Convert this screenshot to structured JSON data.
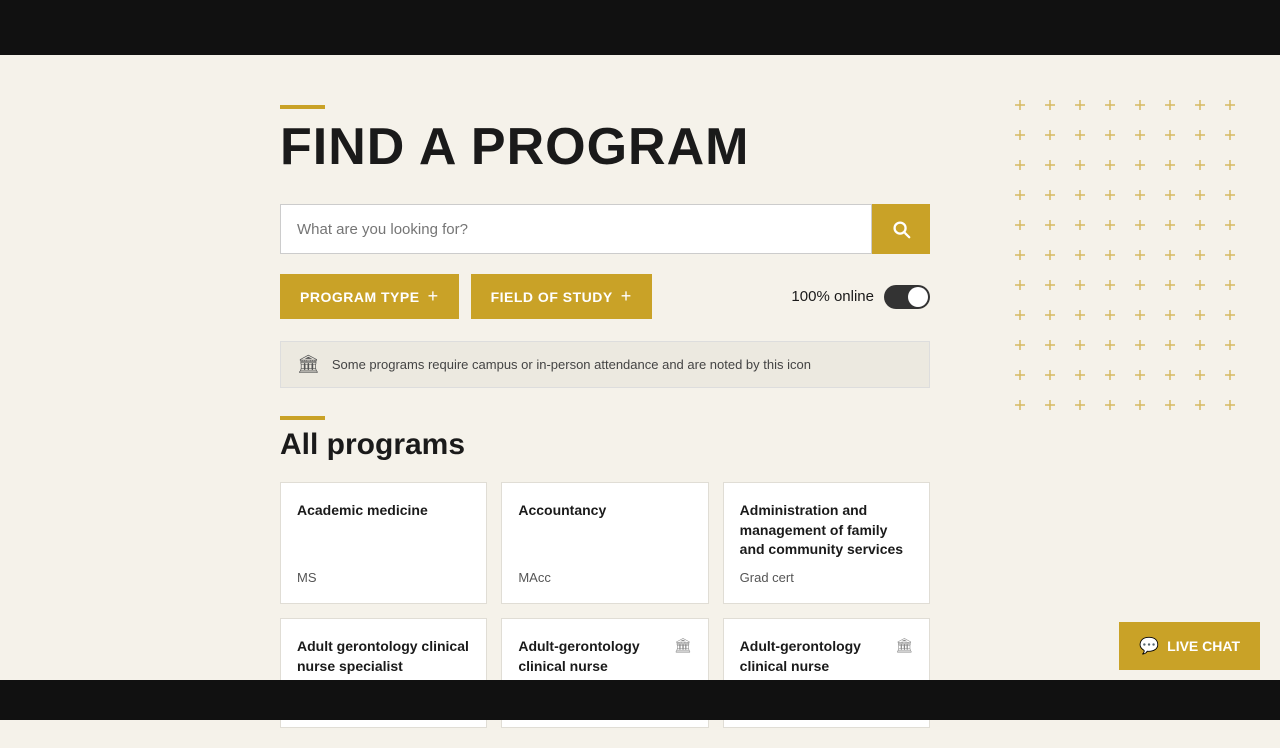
{
  "page": {
    "title": "FIND A PROGRAM",
    "title_accent_color": "#c9a227"
  },
  "search": {
    "placeholder": "What are you looking for?",
    "button_label": "Search"
  },
  "filters": [
    {
      "id": "program-type",
      "label": "PROGRAM TYPE"
    },
    {
      "id": "field-of-study",
      "label": "FIELD OF STUDY"
    }
  ],
  "online_toggle": {
    "label": "100% online",
    "active": true
  },
  "info_banner": {
    "text": "Some programs require campus or in-person attendance and are noted by this icon"
  },
  "programs_section": {
    "title": "All programs"
  },
  "cards": [
    {
      "id": "academic-medicine",
      "title": "Academic medicine",
      "badge": "MS",
      "has_campus_icon": false
    },
    {
      "id": "accountancy",
      "title": "Accountancy",
      "badge": "MAcc",
      "has_campus_icon": false
    },
    {
      "id": "admin-family-community",
      "title": "Administration and management of family and community services",
      "badge": "Grad cert",
      "has_campus_icon": false
    },
    {
      "id": "adult-gero-1",
      "title": "Adult gerontology clinical nurse specialist",
      "badge": "",
      "has_campus_icon": false
    },
    {
      "id": "adult-gero-2",
      "title": "Adult-gerontology clinical nurse specialist",
      "badge": "",
      "has_campus_icon": true
    },
    {
      "id": "adult-gero-3",
      "title": "Adult-gerontology clinical nurse specialist",
      "badge": "",
      "has_campus_icon": true
    }
  ],
  "live_chat": {
    "label": "LIVE CHAT"
  }
}
